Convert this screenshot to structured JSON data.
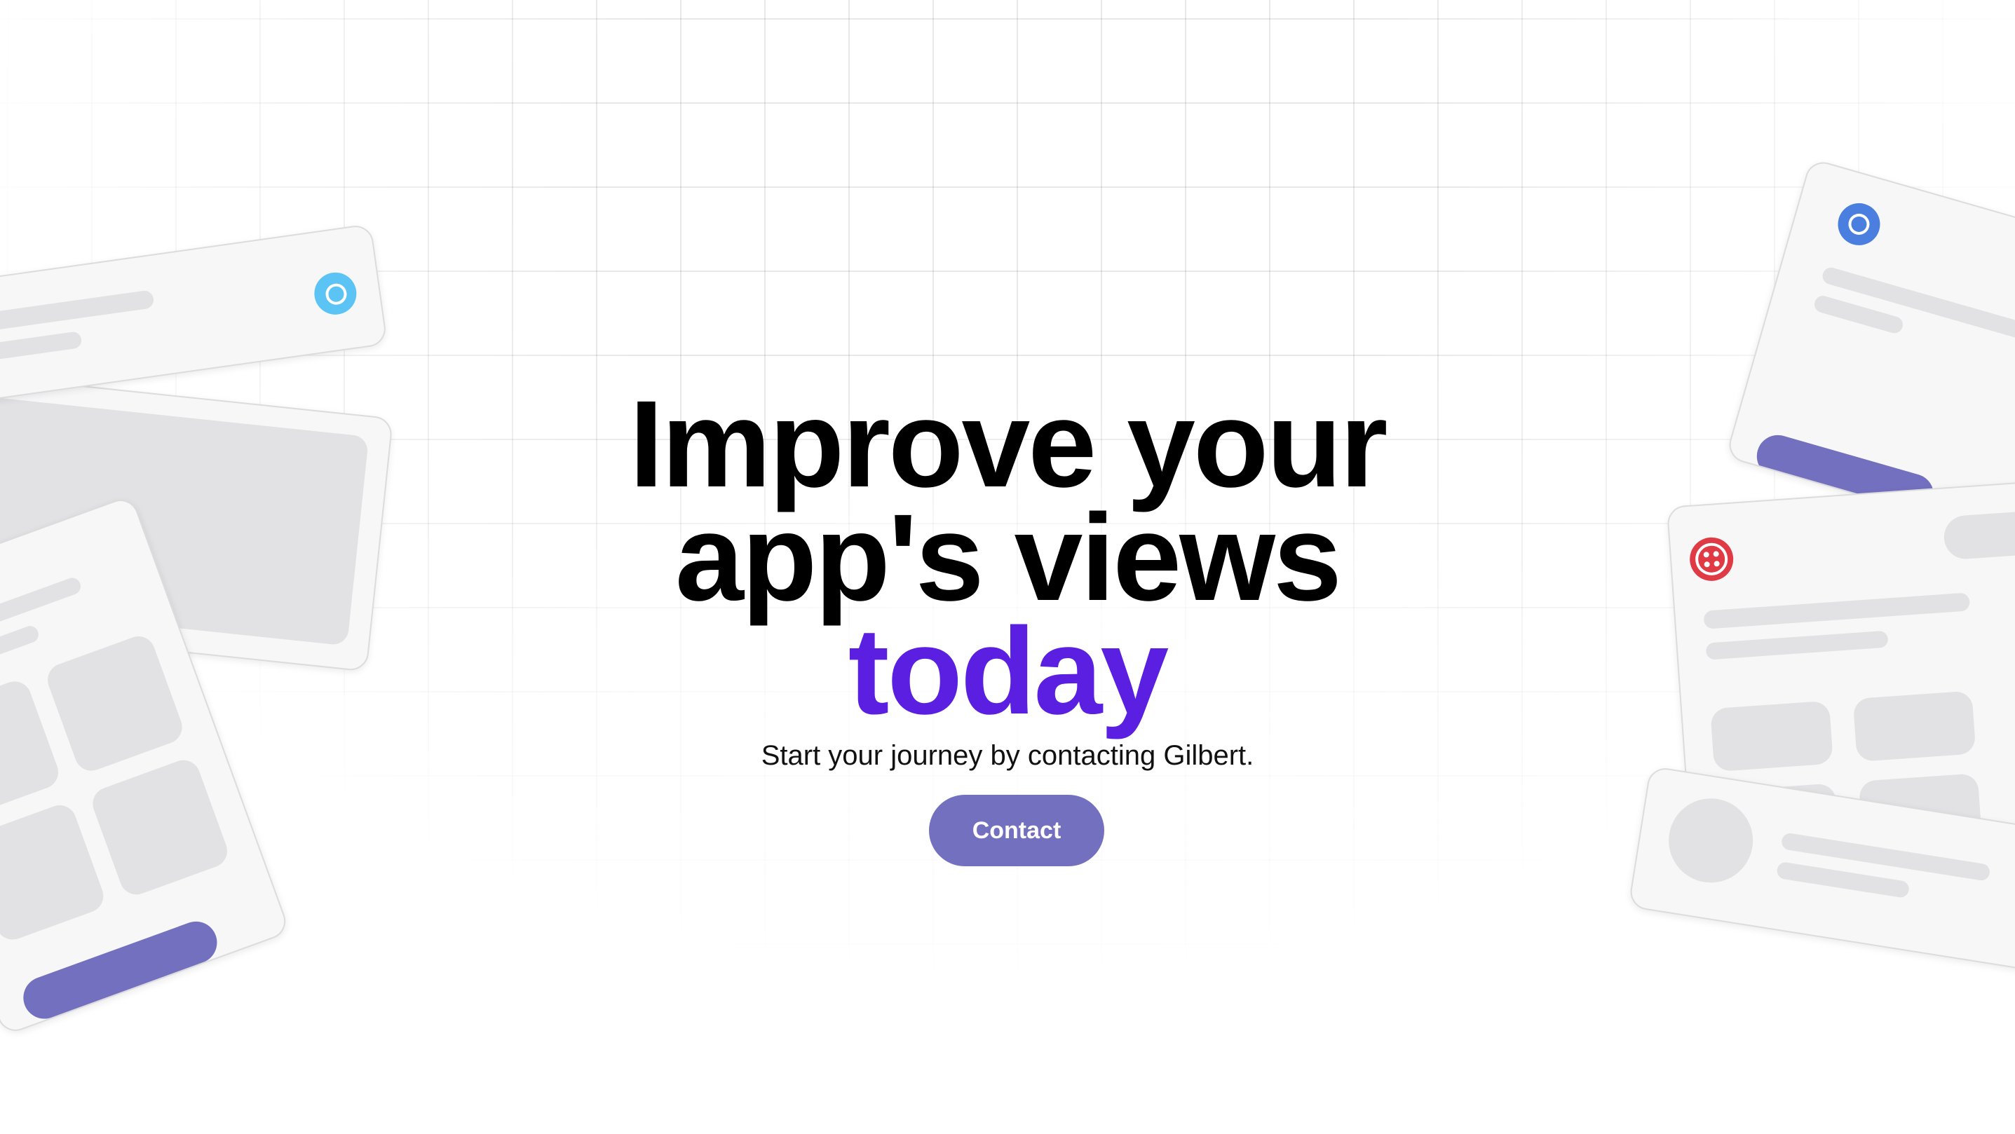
{
  "hero": {
    "title_line_1": "Improve your",
    "title_line_2": "app's views",
    "title_accent": "today",
    "subtitle": "Start your journey by contacting Gilbert.",
    "cta_label": "Contact"
  },
  "colors": {
    "accent_text": "#5a1fe0",
    "button": "#7370c0",
    "card_bg": "#f7f7f8",
    "placeholder": "#e2e2e4",
    "circle_icon": "#5bc4f5",
    "chrome_icon": "#4a7fe0",
    "twilio_icon": "#e03a45"
  },
  "decorations": {
    "left_top_card_icon": "circle-logo-icon",
    "right_top_card_icon": "chrome-icon",
    "right_middle_card_icon": "twilio-icon"
  }
}
